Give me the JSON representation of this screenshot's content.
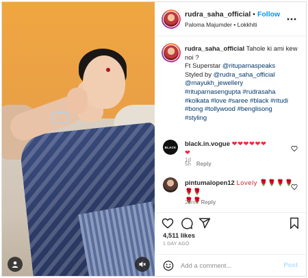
{
  "post": {
    "username": "rudra_saha_official",
    "follow_label": "Follow",
    "location": "Paloma Majumder • Lokkhiti"
  },
  "caption": {
    "username": "rudra_saha_official",
    "lines": [
      "Tahole ki ami kew noi ?",
      "Ft Superstar ",
      "Styled by ",
      "@mayukh_jewellery",
      "#rituparnasengupta #rudrasaha",
      "#kolkata #love #saree #black #ritudi",
      "#bong #tollywood #benglisong",
      "#styling"
    ],
    "mention_superstar": "@rituparnaspeaks",
    "mention_stylist": "@rudra_saha_official",
    "time": "1d"
  },
  "comments": [
    {
      "username": "black.in.vogue",
      "text": "❤❤❤❤❤❤",
      "text2": "❤",
      "time": "5h",
      "reply_label": "Reply",
      "avatar_text": "BLACK"
    },
    {
      "username": "pintumalopen12",
      "text": "Lovely 🌹🌹🌹🌹🌹🌹",
      "text2": "🌹🌹",
      "time": "20m",
      "reply_label": "Reply"
    }
  ],
  "stats": {
    "likes": "4,511 likes",
    "posted": "1 DAY AGO"
  },
  "composer": {
    "placeholder": "Add a comment...",
    "post_label": "Post"
  },
  "icons": {
    "more": "more-horizontal-icon",
    "like": "heart-icon",
    "comment": "comment-icon",
    "share": "send-icon",
    "save": "bookmark-icon",
    "emoji": "smiley-icon",
    "user_tag": "user-icon",
    "mute": "speaker-muted-icon"
  },
  "colors": {
    "accent": "#0095f6",
    "hashtag": "#00376b",
    "muted": "#8e8e8e"
  }
}
